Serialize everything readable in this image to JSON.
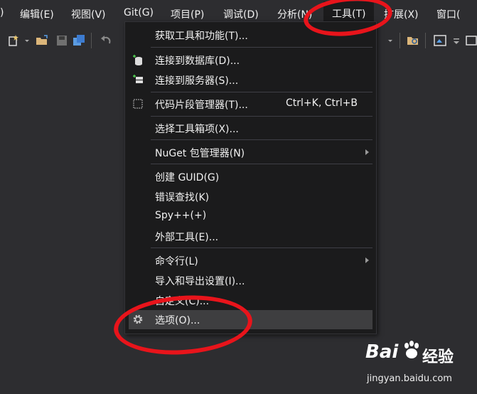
{
  "menubar": {
    "items": [
      {
        "label": ")"
      },
      {
        "label": "编辑(E)"
      },
      {
        "label": "视图(V)"
      },
      {
        "label": "Git(G)"
      },
      {
        "label": "项目(P)"
      },
      {
        "label": "调试(D)"
      },
      {
        "label": "分析(N)"
      },
      {
        "label": "工具(T)"
      },
      {
        "label": "扩展(X)"
      },
      {
        "label": "窗口("
      }
    ]
  },
  "toolbar": {
    "icons": [
      "new-item-icon",
      "open-folder-icon",
      "save-icon",
      "save-all-icon",
      "undo-icon",
      "find-in-files-icon",
      "solution-explorer-icon",
      "overflow-icon"
    ]
  },
  "tools_menu": {
    "items": [
      {
        "label": "获取工具和功能(T)..."
      },
      {
        "label": "连接到数据库(D)...",
        "icon": "database-connect-icon"
      },
      {
        "label": "连接到服务器(S)...",
        "icon": "server-connect-icon"
      },
      {
        "label": "代码片段管理器(T)...",
        "shortcut": "Ctrl+K, Ctrl+B",
        "icon": "snippet-manager-icon"
      },
      {
        "label": "选择工具箱项(X)..."
      },
      {
        "label": "NuGet 包管理器(N)",
        "submenu": true
      },
      {
        "label": "创建 GUID(G)"
      },
      {
        "label": "错误查找(K)"
      },
      {
        "label": "Spy++(+)"
      },
      {
        "label": "外部工具(E)..."
      },
      {
        "label": "命令行(L)",
        "submenu": true
      },
      {
        "label": "导入和导出设置(I)..."
      },
      {
        "label": "自定义(C)..."
      },
      {
        "label": "选项(O)...",
        "icon": "gear-icon",
        "highlighted": true
      }
    ]
  },
  "watermark": {
    "logo_text": "Bai",
    "logo_suffix": "经验",
    "url": "jingyan.baidu.com"
  },
  "colors": {
    "annotation_circle": "#e8141b",
    "menu_background": "#1b1b1c",
    "menu_hover": "#3e3e40"
  }
}
